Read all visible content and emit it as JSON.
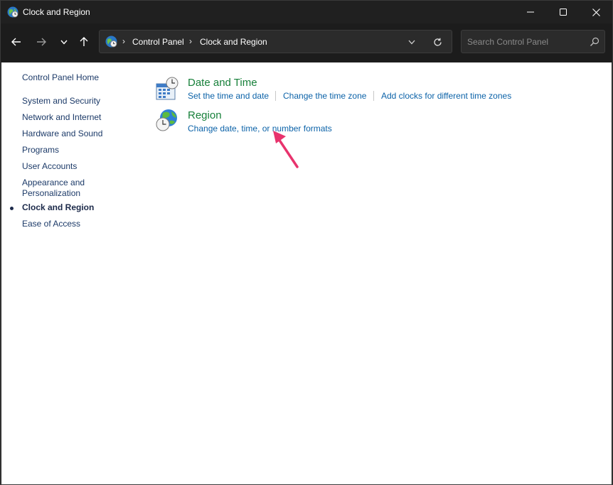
{
  "window": {
    "title": "Clock and Region"
  },
  "address_bar": {
    "breadcrumbs": [
      "Control Panel",
      "Clock and Region"
    ]
  },
  "search": {
    "placeholder": "Search Control Panel",
    "value": ""
  },
  "sidebar": {
    "home": "Control Panel Home",
    "items": [
      {
        "label": "System and Security",
        "active": false
      },
      {
        "label": "Network and Internet",
        "active": false
      },
      {
        "label": "Hardware and Sound",
        "active": false
      },
      {
        "label": "Programs",
        "active": false
      },
      {
        "label": "User Accounts",
        "active": false
      },
      {
        "label": "Appearance and\nPersonalization",
        "active": false
      },
      {
        "label": "Clock and Region",
        "active": true
      },
      {
        "label": "Ease of Access",
        "active": false
      }
    ]
  },
  "categories": [
    {
      "title": "Date and Time",
      "icon": "calendar-clock-icon",
      "tasks": [
        "Set the time and date",
        "Change the time zone",
        "Add clocks for different time zones"
      ]
    },
    {
      "title": "Region",
      "icon": "globe-clock-icon",
      "tasks": [
        "Change date, time, or number formats"
      ]
    }
  ],
  "colors": {
    "category_title": "#17803a",
    "task_link": "#0b62a8",
    "annotation_arrow": "#e8336d"
  }
}
